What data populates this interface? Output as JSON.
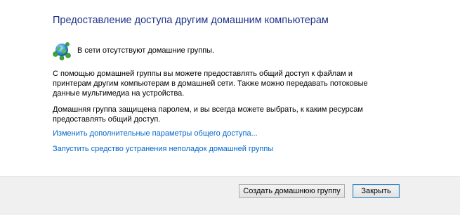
{
  "header": {
    "title": "Предоставление доступа другим домашним компьютерам"
  },
  "status": {
    "icon": "network-globe-icon",
    "text": "В сети отсутствуют домашние группы."
  },
  "paragraphs": [
    "С помощью домашней группы вы можете предоставлять общий доступ к файлам и принтерам другим компьютерам в домашней сети. Также можно передавать потоковые данные мультимедиа на устройства.",
    "Домашняя группа защищена паролем, и вы всегда можете выбрать, к каким ресурсам предоставлять общий доступ."
  ],
  "links": {
    "advanced_sharing": "Изменить дополнительные параметры общего доступа...",
    "troubleshoot": "Запустить средство устранения неполадок домашней группы"
  },
  "buttons": {
    "create": "Создать домашнюю группу",
    "close": "Закрыть"
  },
  "colors": {
    "title": "#1e3287",
    "link": "#0066cc",
    "footer_bg": "#f0f0f0"
  }
}
